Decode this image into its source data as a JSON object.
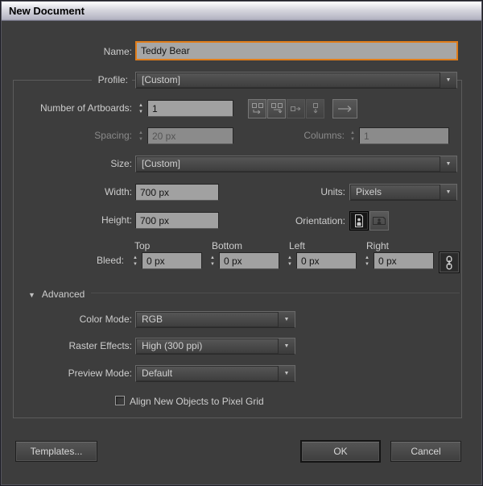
{
  "window": {
    "title": "New Document"
  },
  "form": {
    "name": {
      "label": "Name:",
      "value": "Teddy Bear"
    },
    "profile": {
      "label": "Profile:",
      "value": "[Custom]"
    },
    "artboards": {
      "label": "Number of Artboards:",
      "value": "1"
    },
    "spacing": {
      "label": "Spacing:",
      "value": "20 px"
    },
    "columns": {
      "label": "Columns:",
      "value": "1"
    },
    "size": {
      "label": "Size:",
      "value": "[Custom]"
    },
    "width": {
      "label": "Width:",
      "value": "700 px"
    },
    "units": {
      "label": "Units:",
      "value": "Pixels"
    },
    "height": {
      "label": "Height:",
      "value": "700 px"
    },
    "orientation": {
      "label": "Orientation:"
    },
    "bleed": {
      "label": "Bleed:",
      "top": {
        "label": "Top",
        "value": "0 px"
      },
      "bottom": {
        "label": "Bottom",
        "value": "0 px"
      },
      "left": {
        "label": "Left",
        "value": "0 px"
      },
      "right": {
        "label": "Right",
        "value": "0 px"
      }
    },
    "advanced_label": "Advanced",
    "color_mode": {
      "label": "Color Mode:",
      "value": "RGB"
    },
    "raster_effects": {
      "label": "Raster Effects:",
      "value": "High (300 ppi)"
    },
    "preview_mode": {
      "label": "Preview Mode:",
      "value": "Default"
    },
    "pixel_grid": {
      "label": "Align New Objects to Pixel Grid",
      "checked": false
    }
  },
  "buttons": {
    "templates": "Templates...",
    "ok": "OK",
    "cancel": "Cancel"
  },
  "icons": {
    "dropdown_arrow": "▼",
    "spinner_up": "▲",
    "spinner_down": "▼",
    "advanced_triangle": "▼",
    "link_icon": "chain-link",
    "artboard_grid_by_row": "grid-by-row",
    "artboard_grid_by_column": "grid-by-column",
    "artboard_arrange_by_row": "arrange-by-row",
    "artboard_arrange_by_column": "arrange-by-column",
    "artboard_flow_direction": "right-arrow",
    "orientation_portrait": "portrait-page",
    "orientation_landscape": "landscape-page"
  },
  "colors": {
    "accent_orange": "#E07D1A",
    "dialog_bg": "#3D3D3D",
    "input_bg": "#A1A1A1",
    "disabled_input_bg": "#8B8B8B",
    "dropdown_text": "#CFCFCF",
    "title_text": "#000000"
  }
}
